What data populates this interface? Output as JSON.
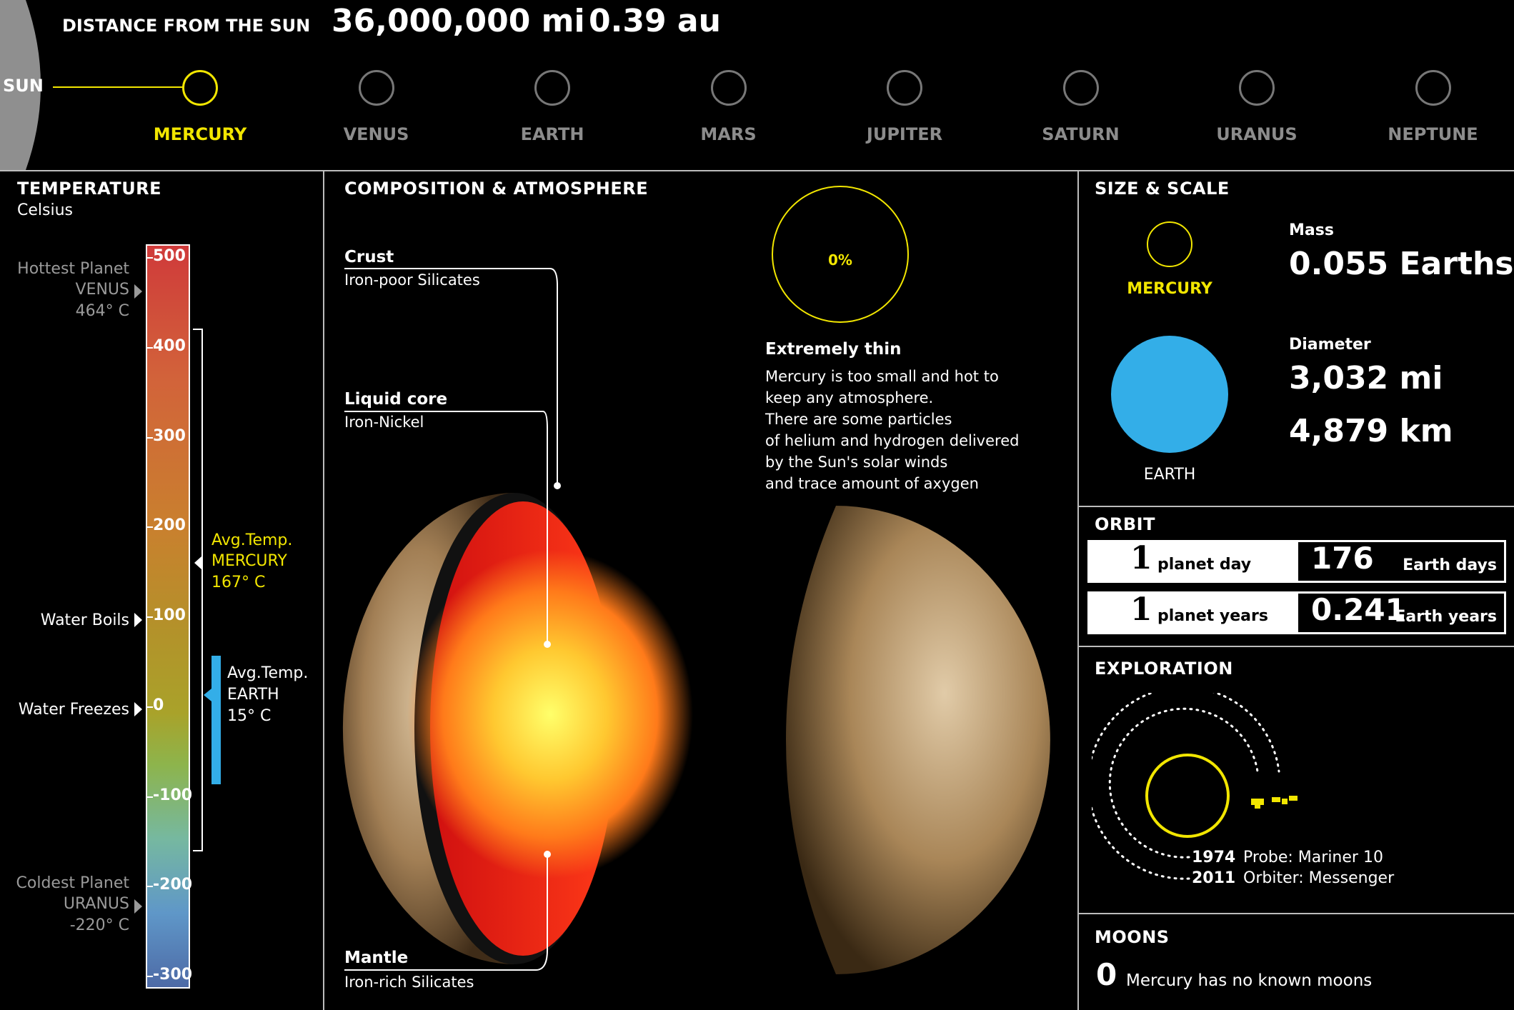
{
  "header": {
    "distance_title": "DISTANCE FROM THE SUN",
    "distance_mi": "36,000,000 mi",
    "distance_au": "0.39 au",
    "sun_label": "SUN",
    "planets": [
      {
        "name": "MERCURY",
        "selected": true
      },
      {
        "name": "VENUS",
        "selected": false
      },
      {
        "name": "EARTH",
        "selected": false
      },
      {
        "name": "MARS",
        "selected": false
      },
      {
        "name": "JUPITER",
        "selected": false
      },
      {
        "name": "SATURN",
        "selected": false
      },
      {
        "name": "URANUS",
        "selected": false
      },
      {
        "name": "NEPTUNE",
        "selected": false
      }
    ]
  },
  "temperature": {
    "title": "TEMPERATURE",
    "unit": "Celsius",
    "ticks": [
      "500",
      "400",
      "300",
      "200",
      "100",
      "0",
      "-100",
      "-200",
      "-300"
    ],
    "hottest": {
      "label": "Hottest Planet",
      "planet": "VENUS",
      "value": "464° C"
    },
    "coldest": {
      "label": "Coldest Planet",
      "planet": "URANUS",
      "value": "-220° C"
    },
    "water_boils": "Water Boils",
    "water_freezes": "Water Freezes",
    "avg_mercury": {
      "label": "Avg.Temp.",
      "planet": "MERCURY",
      "value": "167° C"
    },
    "avg_earth": {
      "label": "Avg.Temp.",
      "planet": "EARTH",
      "value": "15° C"
    }
  },
  "composition": {
    "title": "COMPOSITION & ATMOSPHERE",
    "crust": {
      "label": "Crust",
      "desc": "Iron-poor Silicates"
    },
    "core": {
      "label": "Liquid core",
      "desc": "Iron-Nickel"
    },
    "mantle": {
      "label": "Mantle",
      "desc": "Iron-rich Silicates"
    },
    "atmosphere_percent": "0%",
    "atmosphere_title": "Extremely thin",
    "atmosphere_lines": [
      "Mercury is too small and hot to",
      "keep any atmosphere.",
      "There are some particles",
      "of helium and hydrogen delivered",
      "by the Sun's solar winds",
      "and trace amount of axygen"
    ]
  },
  "size": {
    "title": "SIZE & SCALE",
    "mercury_label": "MERCURY",
    "earth_label": "EARTH",
    "mass_label": "Mass",
    "mass_value": "0.055 Earths",
    "diameter_label": "Diameter",
    "diameter_mi": "3,032 mi",
    "diameter_km": "4,879 km"
  },
  "orbit": {
    "title": "ORBIT",
    "rows": [
      {
        "num": "1",
        "unit": "planet day",
        "value": "176",
        "value_unit": "Earth days"
      },
      {
        "num": "1",
        "unit": "planet years",
        "value": "0.241",
        "value_unit": "Earth years"
      }
    ]
  },
  "exploration": {
    "title": "EXPLORATION",
    "missions": [
      {
        "year": "1974",
        "desc": "Probe: Mariner 10"
      },
      {
        "year": "2011",
        "desc": "Orbiter: Messenger"
      }
    ]
  },
  "moons": {
    "title": "MOONS",
    "count": "0",
    "desc": "Mercury has no known moons"
  },
  "colors": {
    "accent_yellow": "#f2e600",
    "earth_blue": "#33aee8",
    "divider": "#bdbdbd"
  }
}
